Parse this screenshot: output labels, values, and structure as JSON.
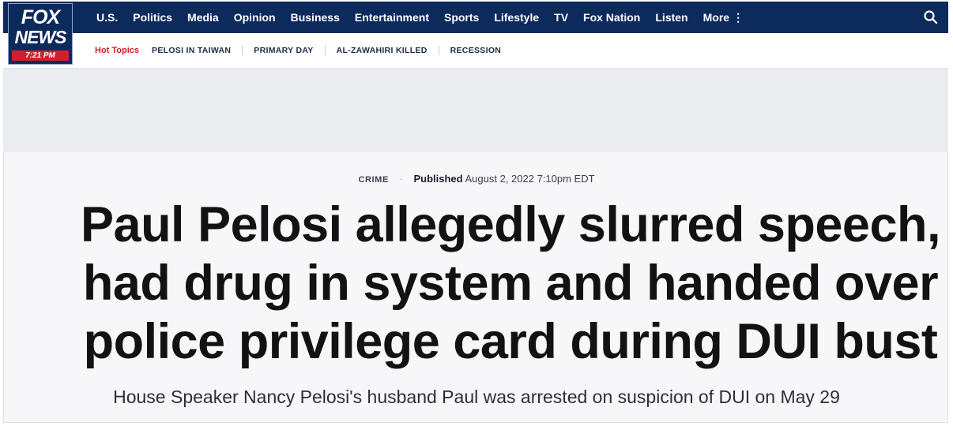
{
  "logo": {
    "line1": "FOX",
    "line2": "NEWS",
    "time": "7:21 PM"
  },
  "nav": {
    "items": [
      "U.S.",
      "Politics",
      "Media",
      "Opinion",
      "Business",
      "Entertainment",
      "Sports",
      "Lifestyle",
      "TV",
      "Fox Nation",
      "Listen",
      "More"
    ],
    "more_dots": "⋮"
  },
  "hot_topics": {
    "label": "Hot Topics",
    "items": [
      "PELOSI IN TAIWAN",
      "PRIMARY DAY",
      "AL-ZAWAHIRI KILLED",
      "RECESSION"
    ]
  },
  "article": {
    "category": "CRIME",
    "published_label": "Published",
    "published_date": "August 2, 2022 7:10pm EDT",
    "headline": "Paul Pelosi allegedly slurred speech, had drug in system and handed over police privilege card during DUI bust",
    "dek": "House Speaker Nancy Pelosi's husband Paul was arrested on suspicion of DUI on May 29"
  },
  "colors": {
    "nav_bg": "#0d2a5c",
    "accent_red": "#d01f2f"
  },
  "icons": {
    "search": "search-icon"
  }
}
